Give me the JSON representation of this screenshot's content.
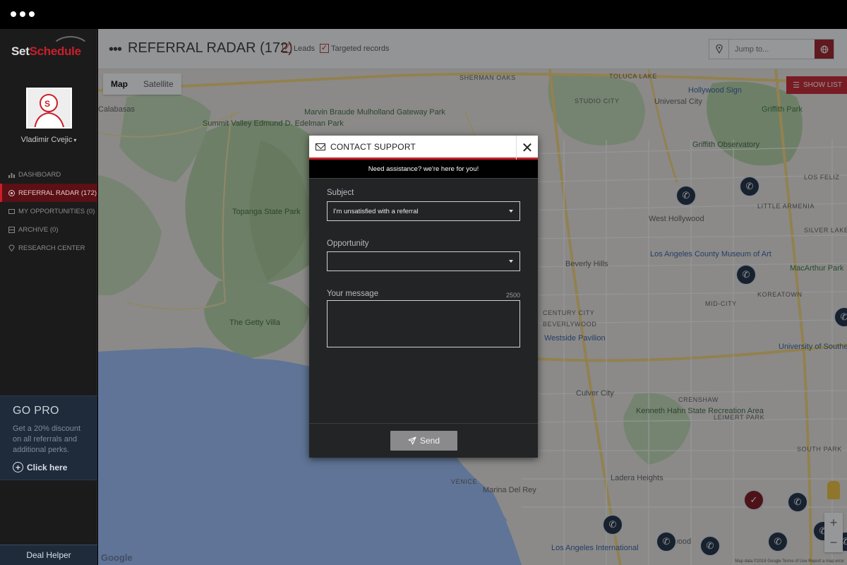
{
  "sidebar": {
    "logo_part1": "Set",
    "logo_part2": "Schedule",
    "username": "Vladimir Cvejic",
    "nav": [
      {
        "label": "DASHBOARD",
        "icon": "bar-chart-icon"
      },
      {
        "label": "REFERRAL RADAR (172)",
        "icon": "radar-icon",
        "active": true
      },
      {
        "label": "MY OPPORTUNITIES (0)",
        "icon": "inbox-icon"
      },
      {
        "label": "ARCHIVE (0)",
        "icon": "archive-icon"
      },
      {
        "label": "RESEARCH CENTER",
        "icon": "location-icon"
      }
    ],
    "gopro": {
      "title": "GO PRO",
      "text": "Get a 20% discount on all referrals and additional perks.",
      "cta": "Click here"
    },
    "deal_helper": "Deal Helper"
  },
  "topbar": {
    "title": "REFERRAL RADAR (172)",
    "filters": [
      {
        "label": "Leads",
        "checked": true
      },
      {
        "label": "Targeted records",
        "checked": true
      }
    ],
    "jump_placeholder": "Jump to..."
  },
  "map": {
    "type_options": [
      "Map",
      "Satellite"
    ],
    "selected_type": "Map",
    "show_list": "SHOW LIST",
    "google_logo": "Google",
    "attribution": "Map data ©2018 Google   Terms of Use   Report a map error",
    "labels": [
      "SHERMAN OAKS",
      "TOLUCA LAKE",
      "Hollywood Sign",
      "STUDIO CITY",
      "Universal City",
      "Griffith Park",
      "Calabasas",
      "Summit Valley Edmund D. Edelman Park",
      "Marvin Braude Mulholland Gateway Park",
      "Griffith Observatory",
      "LOS FELIZ",
      "LITTLE ARMENIA",
      "Topanga State Park",
      "West Hollywood",
      "SILVER LAKE",
      "Los Angeles County Museum of Art",
      "Beverly Hills",
      "MacArthur Park",
      "KOREATOWN",
      "The Getty Villa",
      "CENTURY CITY",
      "BEVERLYWOOD",
      "MID-CITY",
      "Westside Pavilion",
      "University of Southern California",
      "Culver City",
      "CRENSHAW",
      "Kenneth Hahn State Recreation Area",
      "LEIMERT PARK",
      "SOUTH PARK",
      "Ladera Heights",
      "Marina Del Rey",
      "VENICE",
      "Los Angeles International",
      "Inglewood"
    ]
  },
  "modal": {
    "title": "CONTACT SUPPORT",
    "subtitle": "Need assistance? we're here for you!",
    "subject_label": "Subject",
    "subject_value": "I'm unsatisfied with a referral",
    "opportunity_label": "Opportunity",
    "opportunity_value": "",
    "message_label": "Your message",
    "message_counter": "2500",
    "message_value": "",
    "send_label": "Send"
  },
  "colors": {
    "accent": "#c8202a",
    "sidebar_bg": "#1b1b1c",
    "modal_bg": "#232426",
    "gopro_bg": "#1f2b3a"
  }
}
